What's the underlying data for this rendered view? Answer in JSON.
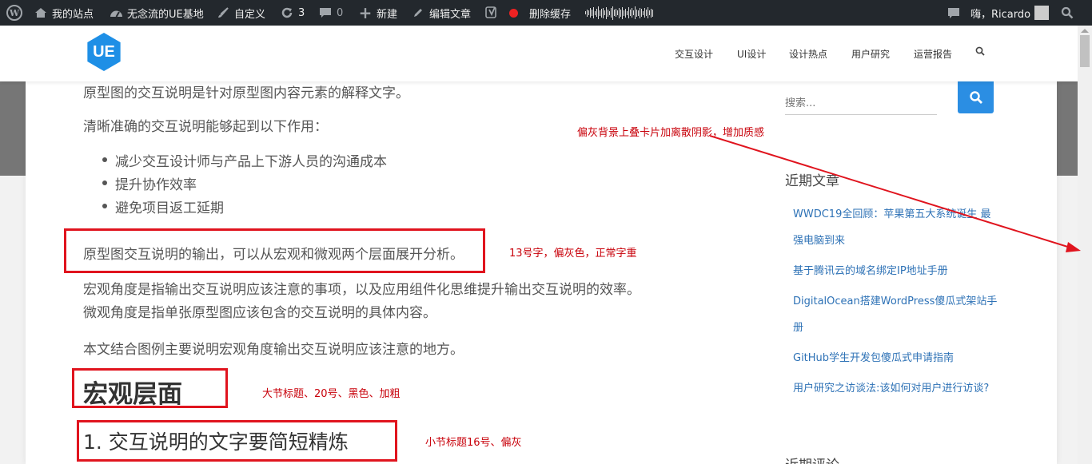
{
  "adminbar": {
    "wp_logo": "W",
    "my_sites": "我的站点",
    "site_name": "无念流的UE基地",
    "customize": "自定义",
    "updates_count": "3",
    "comments_count": "0",
    "new": "新建",
    "edit_post": "编辑文章",
    "clear_cache": "删除缓存",
    "greeting": "嗨，Ricardo"
  },
  "header": {
    "logo_text": "UE",
    "nav": [
      "交互设计",
      "UI设计",
      "设计热点",
      "用户研究",
      "运营报告"
    ]
  },
  "article": {
    "p1": "原型图的交互说明是针对原型图内容元素的解释文字。",
    "p2": "清晰准确的交互说明能够起到以下作用：",
    "bullets": [
      "减少交互设计师与产品上下游人员的沟通成本",
      "提升协作效率",
      "避免项目返工延期"
    ],
    "p3": "原型图交互说明的输出，可以从宏观和微观两个层面展开分析。",
    "p4a": "宏观角度是指输出交互说明应该注意的事项，以及应用组件化思维提升输出交互说明的效率。",
    "p4b": "微观角度是指单张原型图应该包含的交互说明的具体内容。",
    "p5": "本文结合图例主要说明宏观角度输出交互说明应该注意的地方。",
    "h2": "宏观层面",
    "h3": "1. 交互说明的文字要简短精炼"
  },
  "annotations": {
    "shadow": "偏灰背景上叠卡片加离散阴影，增加质感",
    "body_text": "13号字，偏灰色，正常字重",
    "section_title": "大节标题、20号、黑色、加粗",
    "subsection_title": "小节标题16号、偏灰"
  },
  "sidebar": {
    "search_placeholder": "搜索...",
    "recent_posts_title": "近期文章",
    "recent_posts": [
      "WWDC19全回顾：苹果第五大系统诞生 最强电脑到来",
      "基于腾讯云的域名绑定IP地址手册",
      "DigitalOcean搭建WordPress傻瓜式架站手册",
      "GitHub学生开发包傻瓜式申请指南",
      "用户研究之访谈法:该如何对用户进行访谈?"
    ],
    "recent_comments_title": "近期评论"
  },
  "colors": {
    "admin_bar": "#23282d",
    "accent": "#2b8ee3",
    "annotation_red": "#e0141e",
    "link": "#2e72b6"
  }
}
